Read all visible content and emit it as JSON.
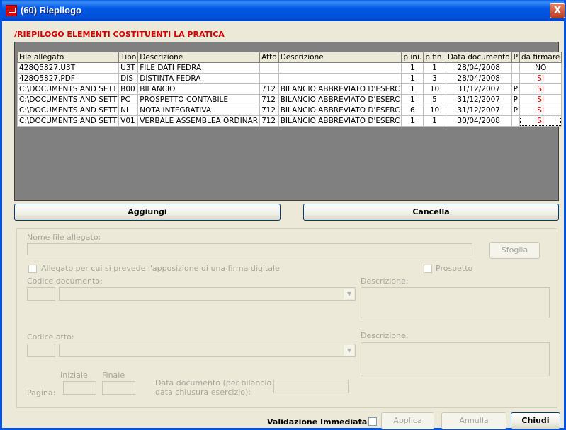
{
  "window": {
    "title": "(60) Riepilogo",
    "close": "X"
  },
  "heading": "/RIEPILOGO ELEMENTI COSTITUENTI LA PRATICA",
  "grid": {
    "columns": [
      "File allegato",
      "Tipo",
      "Descrizione",
      "Atto",
      "Descrizione",
      "p.ini.",
      "p.fin.",
      "Data documento",
      "P",
      "da firmare"
    ],
    "rows": [
      [
        "428Q5827.U3T",
        "U3T",
        "FILE DATI FEDRA",
        "",
        "",
        "1",
        "1",
        "28/04/2008",
        "",
        "NO"
      ],
      [
        "428Q5827.PDF",
        "DIS",
        "DISTINTA FEDRA",
        "",
        "",
        "1",
        "3",
        "28/04/2008",
        "",
        "SI"
      ],
      [
        "C:\\DOCUMENTS AND SETT",
        "B00",
        "BILANCIO",
        "712",
        "BILANCIO ABBREVIATO D'ESERC",
        "1",
        "10",
        "31/12/2007",
        "P",
        "SI"
      ],
      [
        "C:\\DOCUMENTS AND SETT",
        "PC",
        "PROSPETTO CONTABILE",
        "712",
        "BILANCIO ABBREVIATO D'ESERC",
        "1",
        "5",
        "31/12/2007",
        "P",
        "SI"
      ],
      [
        "C:\\DOCUMENTS AND SETT",
        "NI",
        "NOTA INTEGRATIVA",
        "712",
        "BILANCIO ABBREVIATO D'ESERC",
        "6",
        "10",
        "31/12/2007",
        "P",
        "SI"
      ],
      [
        "C:\\DOCUMENTS AND SETT",
        "V01",
        "VERBALE ASSEMBLEA ORDINAR",
        "712",
        "BILANCIO ABBREVIATO D'ESERC",
        "1",
        "1",
        "30/04/2008",
        "",
        "SI"
      ]
    ]
  },
  "buttons": {
    "add": "Aggiungi",
    "delete": "Cancella"
  },
  "form": {
    "file_label": "Nome file allegato:",
    "browse": "Sfoglia",
    "digital_sig_label": "Allegato per cui si prevede l'apposizione di una firma digitale",
    "prospetto_label": "Prospetto",
    "doc_code_label": "Codice documento:",
    "doc_desc_label": "Descrizione:",
    "act_code_label": "Codice atto:",
    "act_desc_label": "Descrizione:",
    "initial_label": "Iniziale",
    "final_label": "Finale",
    "page_label": "Pagina:",
    "doc_date_label_1": "Data documento (per bilancio",
    "doc_date_label_2": "data chiusura esercizio):"
  },
  "footer": {
    "validation_label": "Validazione Immediata",
    "apply": "Applica",
    "cancel": "Annulla",
    "close": "Chiudi"
  },
  "colors": {
    "title_bar": "#0054e3",
    "heading": "#d30000",
    "signature_flag": "#d30000"
  }
}
